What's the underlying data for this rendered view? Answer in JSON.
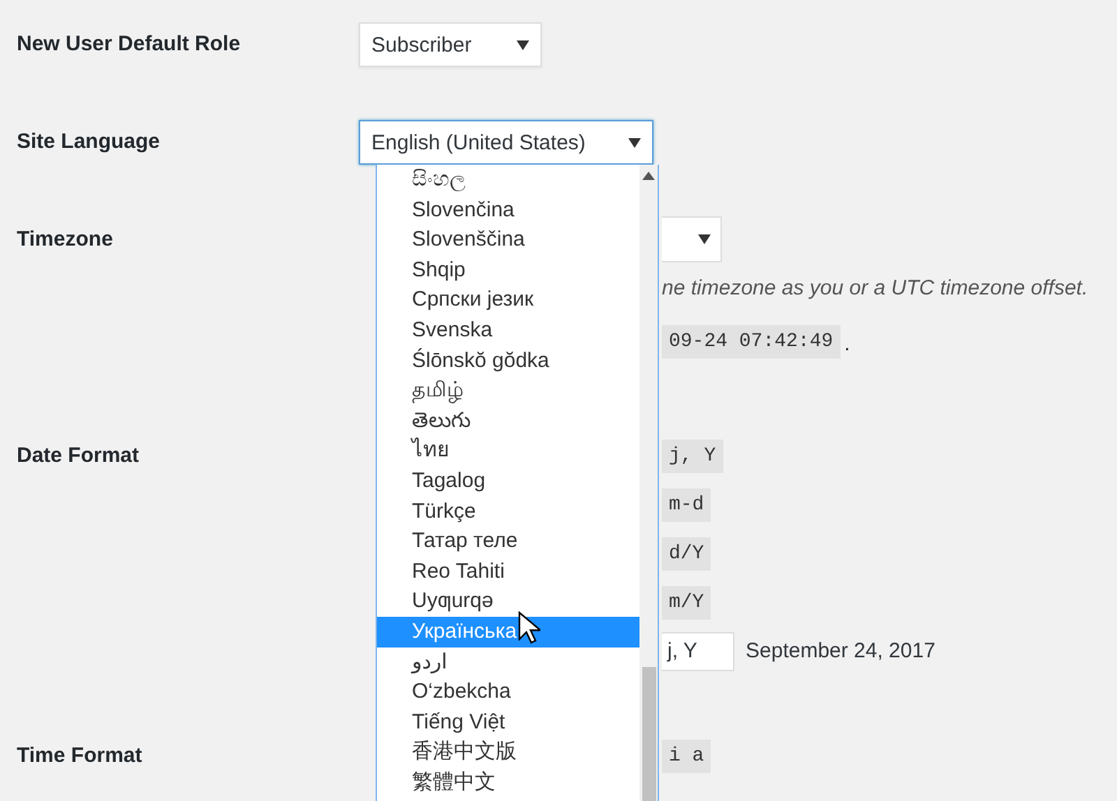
{
  "default_role": {
    "label": "New User Default Role",
    "value": "Subscriber"
  },
  "site_language": {
    "label": "Site Language",
    "value": "English (United States)",
    "options": [
      {
        "label": "සිංහල",
        "selected": false
      },
      {
        "label": "Slovenčina",
        "selected": false
      },
      {
        "label": "Slovenščina",
        "selected": false
      },
      {
        "label": "Shqip",
        "selected": false
      },
      {
        "label": "Српски језик",
        "selected": false
      },
      {
        "label": "Svenska",
        "selected": false
      },
      {
        "label": "Ślōnskŏ gŏdka",
        "selected": false
      },
      {
        "label": "தமிழ்",
        "selected": false
      },
      {
        "label": "తెలుగు",
        "selected": false
      },
      {
        "label": "ไทย",
        "selected": false
      },
      {
        "label": "Tagalog",
        "selected": false
      },
      {
        "label": "Türkçe",
        "selected": false
      },
      {
        "label": "Татар теле",
        "selected": false
      },
      {
        "label": "Reo Tahiti",
        "selected": false
      },
      {
        "label": "Uyƣurqə",
        "selected": false
      },
      {
        "label": "Українська",
        "selected": true
      },
      {
        "label": "اردو",
        "selected": false
      },
      {
        "label": "O‘zbekcha",
        "selected": false
      },
      {
        "label": "Tiếng Việt",
        "selected": false
      },
      {
        "label": "香港中文版",
        "selected": false
      },
      {
        "label": "繁體中文",
        "selected": false
      }
    ]
  },
  "timezone": {
    "label": "Timezone",
    "description": "ne timezone as you or a UTC timezone offset.",
    "local_time": "09-24 07:42:49",
    "local_time_suffix": "."
  },
  "date_format": {
    "label": "Date Format",
    "options": [
      {
        "kind": "preset",
        "format": "j, Y"
      },
      {
        "kind": "preset",
        "format": "m-d"
      },
      {
        "kind": "preset",
        "format": "d/Y"
      },
      {
        "kind": "preset",
        "format": "m/Y"
      },
      {
        "kind": "custom",
        "format": "j, Y",
        "preview": "September 24, 2017"
      }
    ]
  },
  "time_format": {
    "label": "Time Format",
    "options": [
      {
        "kind": "preset",
        "format": "i a"
      }
    ]
  }
}
